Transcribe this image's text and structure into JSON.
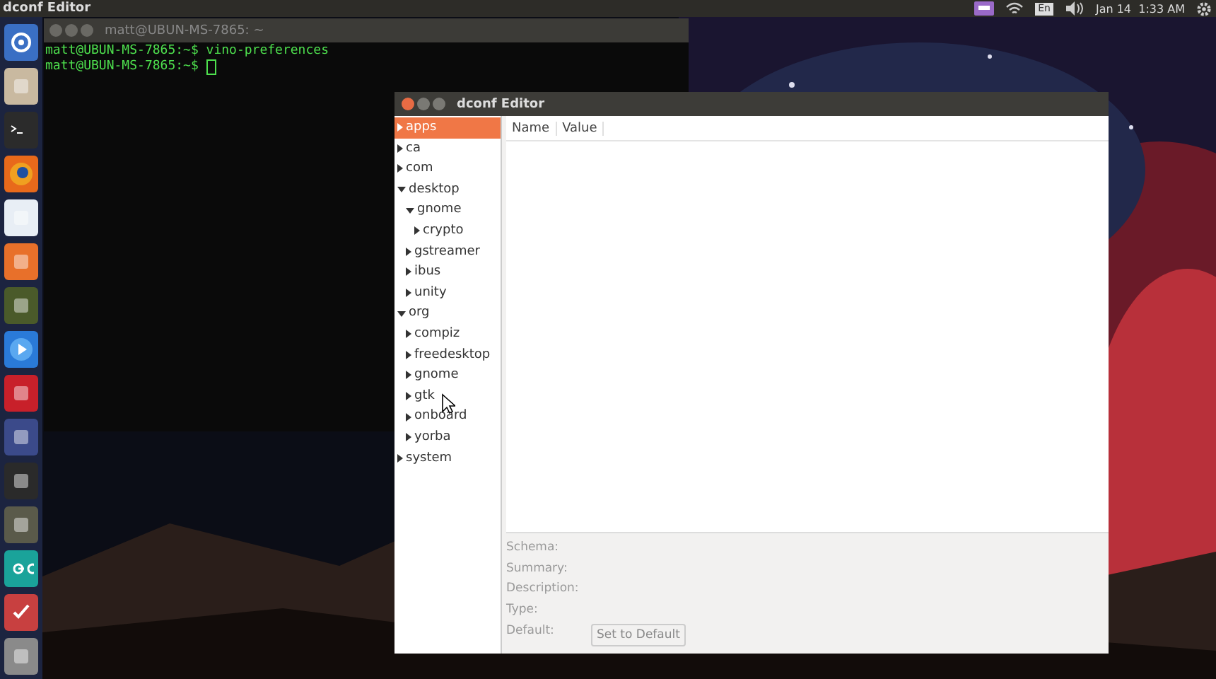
{
  "top_panel": {
    "title": "dconf Editor",
    "keyboard_layout": "En",
    "clock": "Jan 14  1:33 AM"
  },
  "launcher": {
    "items": [
      {
        "kind": "dash"
      },
      {
        "kind": "files"
      },
      {
        "kind": "terminal"
      },
      {
        "kind": "browser"
      },
      {
        "kind": "document"
      },
      {
        "kind": "store"
      },
      {
        "kind": "drink"
      },
      {
        "kind": "player"
      },
      {
        "kind": "ftp"
      },
      {
        "kind": "network"
      },
      {
        "kind": "vector"
      },
      {
        "kind": "painter"
      },
      {
        "kind": "infinity"
      },
      {
        "kind": "check"
      },
      {
        "kind": "trash"
      }
    ]
  },
  "terminal": {
    "title": "matt@UBUN-MS-7865: ~",
    "lines": [
      "matt@UBUN-MS-7865:~$ vino-preferences",
      "matt@UBUN-MS-7865:~$ "
    ]
  },
  "dconf": {
    "title": "dconf Editor",
    "tree": [
      {
        "label": "apps",
        "expanded": false,
        "selected": true
      },
      {
        "label": "ca",
        "expanded": false,
        "selected": false
      },
      {
        "label": "com",
        "expanded": false,
        "selected": false
      },
      {
        "label": "desktop",
        "expanded": true,
        "selected": false,
        "children": [
          {
            "label": "gnome",
            "expanded": true,
            "selected": false,
            "children": [
              {
                "label": "crypto",
                "expanded": false,
                "selected": false
              }
            ]
          },
          {
            "label": "gstreamer",
            "expanded": false,
            "selected": false
          },
          {
            "label": "ibus",
            "expanded": false,
            "selected": false
          },
          {
            "label": "unity",
            "expanded": false,
            "selected": false
          }
        ]
      },
      {
        "label": "org",
        "expanded": true,
        "selected": false,
        "children": [
          {
            "label": "compiz",
            "expanded": false,
            "selected": false
          },
          {
            "label": "freedesktop",
            "expanded": false,
            "selected": false
          },
          {
            "label": "gnome",
            "expanded": false,
            "selected": false
          },
          {
            "label": "gtk",
            "expanded": false,
            "selected": false
          },
          {
            "label": "onboard",
            "expanded": false,
            "selected": false
          },
          {
            "label": "yorba",
            "expanded": false,
            "selected": false
          }
        ]
      },
      {
        "label": "system",
        "expanded": false,
        "selected": false
      }
    ],
    "columns": [
      "Name",
      "Value"
    ],
    "details": [
      "Schema:",
      "Summary:",
      "Description:",
      "Type:",
      "Default:"
    ],
    "default_button": {
      "label": "Set to Default",
      "disabled": true
    }
  }
}
